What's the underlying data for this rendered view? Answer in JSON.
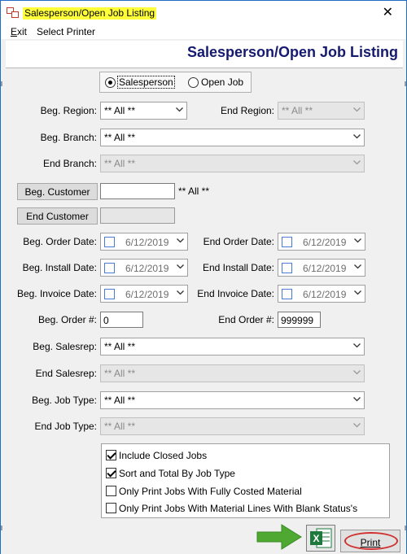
{
  "window": {
    "title": "Salesperson/Open Job Listing"
  },
  "menu": {
    "exit": "Exit",
    "select_printer": "Select Printer"
  },
  "header": {
    "title": "Salesperson/Open Job Listing"
  },
  "report_type": {
    "options": [
      "Salesperson",
      "Open Job"
    ],
    "selected": "Salesperson"
  },
  "fields": {
    "beg_region": {
      "label": "Beg. Region:",
      "value": "** All **"
    },
    "end_region": {
      "label": "End Region:",
      "value": "** All **"
    },
    "beg_branch": {
      "label": "Beg. Branch:",
      "value": "** All **"
    },
    "end_branch": {
      "label": "End Branch:",
      "value": "** All **"
    },
    "beg_customer": {
      "button": "Beg. Customer",
      "value": "",
      "hint": "** All **"
    },
    "end_customer": {
      "button": "End Customer",
      "value": ""
    },
    "beg_order_date": {
      "label": "Beg. Order Date:",
      "value": "6/12/2019"
    },
    "end_order_date": {
      "label": "End Order Date:",
      "value": "6/12/2019"
    },
    "beg_install_date": {
      "label": "Beg. Install Date:",
      "value": "6/12/2019"
    },
    "end_install_date": {
      "label": "End Install Date:",
      "value": "6/12/2019"
    },
    "beg_invoice_date": {
      "label": "Beg. Invoice Date:",
      "value": "6/12/2019"
    },
    "end_invoice_date": {
      "label": "End Invoice Date:",
      "value": "6/12/2019"
    },
    "beg_order_no": {
      "label": "Beg. Order #:",
      "value": "0"
    },
    "end_order_no": {
      "label": "End Order #:",
      "value": "999999"
    },
    "beg_salesrep": {
      "label": "Beg. Salesrep:",
      "value": "** All **"
    },
    "end_salesrep": {
      "label": "End Salesrep:",
      "value": "** All **"
    },
    "beg_job_type": {
      "label": "Beg. Job Type:",
      "value": "** All **"
    },
    "end_job_type": {
      "label": "End Job Type:",
      "value": "** All **"
    }
  },
  "options": [
    {
      "label": "Include Closed Jobs",
      "checked": true
    },
    {
      "label": "Sort and Total By Job Type",
      "checked": true
    },
    {
      "label": "Only Print Jobs With Fully Costed Material",
      "checked": false
    },
    {
      "label": "Only Print Jobs With Material Lines With Blank Status's",
      "checked": false
    }
  ],
  "buttons": {
    "print": "Print",
    "excel_icon": "excel-export-icon"
  },
  "colors": {
    "title_highlight": "#ffff3a",
    "header_text": "#151a6f",
    "arrow": "#4ea832",
    "print_ring": "#d03030"
  }
}
